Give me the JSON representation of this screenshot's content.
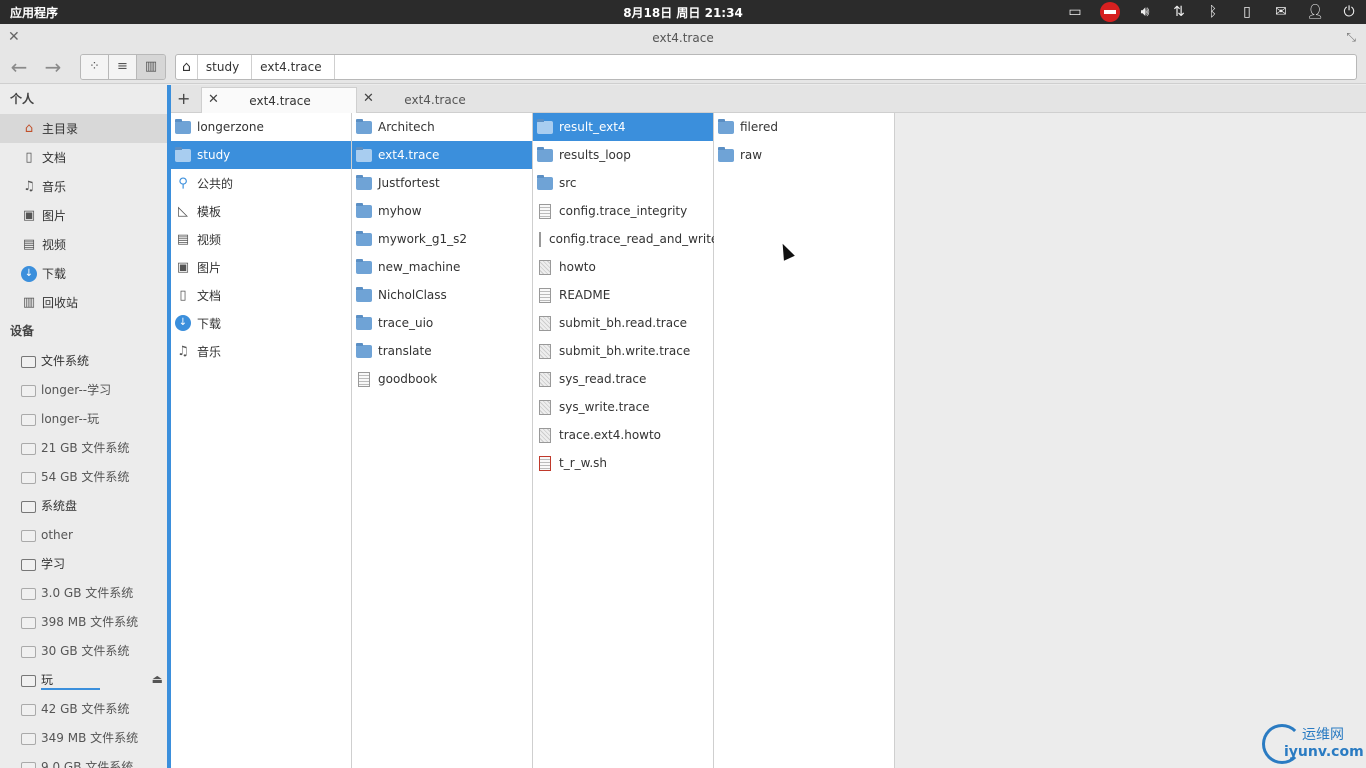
{
  "topbar": {
    "apps_label": "应用程序",
    "clock": "8月18日 周日 21:34",
    "tray_icons": [
      "network-wired-icon",
      "stop-icon",
      "volume-icon",
      "transfer-icon",
      "bluetooth-icon",
      "battery-icon",
      "mail-icon",
      "user-icon",
      "power-icon"
    ]
  },
  "window": {
    "title": "ext4.trace"
  },
  "pathbar": {
    "crumbs": [
      "study",
      "ext4.trace"
    ]
  },
  "sidebar": {
    "personal_header": "个人",
    "personal": [
      {
        "label": "主目录",
        "icon": "home-icon"
      },
      {
        "label": "文档",
        "icon": "document-icon"
      },
      {
        "label": "音乐",
        "icon": "music-icon"
      },
      {
        "label": "图片",
        "icon": "picture-icon"
      },
      {
        "label": "视频",
        "icon": "video-icon"
      },
      {
        "label": "下载",
        "icon": "download-icon"
      },
      {
        "label": "回收站",
        "icon": "trash-icon"
      }
    ],
    "devices_header": "设备",
    "devices": [
      {
        "label": "文件系统"
      },
      {
        "label": "longer--学习"
      },
      {
        "label": "longer--玩"
      },
      {
        "label": "21 GB 文件系统"
      },
      {
        "label": "54 GB 文件系统"
      },
      {
        "label": "系统盘"
      },
      {
        "label": "other"
      },
      {
        "label": "学习"
      },
      {
        "label": "3.0 GB 文件系统"
      },
      {
        "label": "398 MB 文件系统"
      },
      {
        "label": "30 GB 文件系统"
      },
      {
        "label": "玩"
      },
      {
        "label": "42 GB 文件系统"
      },
      {
        "label": "349 MB 文件系统"
      },
      {
        "label": "9.0 GB 文件系统"
      }
    ]
  },
  "tabs": [
    {
      "label": "ext4.trace",
      "active": true
    },
    {
      "label": "ext4.trace",
      "active": false
    }
  ],
  "columns": [
    [
      {
        "name": "longerzone",
        "type": "folder"
      },
      {
        "name": "study",
        "type": "folder",
        "selected": true
      },
      {
        "name": "公共的",
        "type": "share"
      },
      {
        "name": "模板",
        "type": "template"
      },
      {
        "name": "视频",
        "type": "video"
      },
      {
        "name": "图片",
        "type": "picture"
      },
      {
        "name": "文档",
        "type": "document"
      },
      {
        "name": "下载",
        "type": "download"
      },
      {
        "name": "音乐",
        "type": "music"
      }
    ],
    [
      {
        "name": "Architech",
        "type": "folder"
      },
      {
        "name": "ext4.trace",
        "type": "folder",
        "selected": true
      },
      {
        "name": "Justfortest",
        "type": "folder"
      },
      {
        "name": "myhow",
        "type": "folder"
      },
      {
        "name": "mywork_g1_s2",
        "type": "folder"
      },
      {
        "name": "new_machine",
        "type": "folder"
      },
      {
        "name": "NicholClass",
        "type": "folder"
      },
      {
        "name": "trace_uio",
        "type": "folder"
      },
      {
        "name": "translate",
        "type": "folder"
      },
      {
        "name": "goodbook",
        "type": "text"
      }
    ],
    [
      {
        "name": "result_ext4",
        "type": "folder",
        "selected": true
      },
      {
        "name": "results_loop",
        "type": "folder"
      },
      {
        "name": "src",
        "type": "folder"
      },
      {
        "name": "config.trace_integrity",
        "type": "text"
      },
      {
        "name": "config.trace_read_and_write",
        "type": "text"
      },
      {
        "name": "howto",
        "type": "gray"
      },
      {
        "name": "README",
        "type": "text"
      },
      {
        "name": "submit_bh.read.trace",
        "type": "gray"
      },
      {
        "name": "submit_bh.write.trace",
        "type": "gray"
      },
      {
        "name": "sys_read.trace",
        "type": "gray"
      },
      {
        "name": "sys_write.trace",
        "type": "gray"
      },
      {
        "name": "trace.ext4.howto",
        "type": "gray"
      },
      {
        "name": "t_r_w.sh",
        "type": "script"
      }
    ],
    [
      {
        "name": "filered",
        "type": "folder"
      },
      {
        "name": "raw",
        "type": "folder"
      }
    ]
  ],
  "watermark": {
    "cn": "运维网",
    "en": "iyunv.com"
  }
}
